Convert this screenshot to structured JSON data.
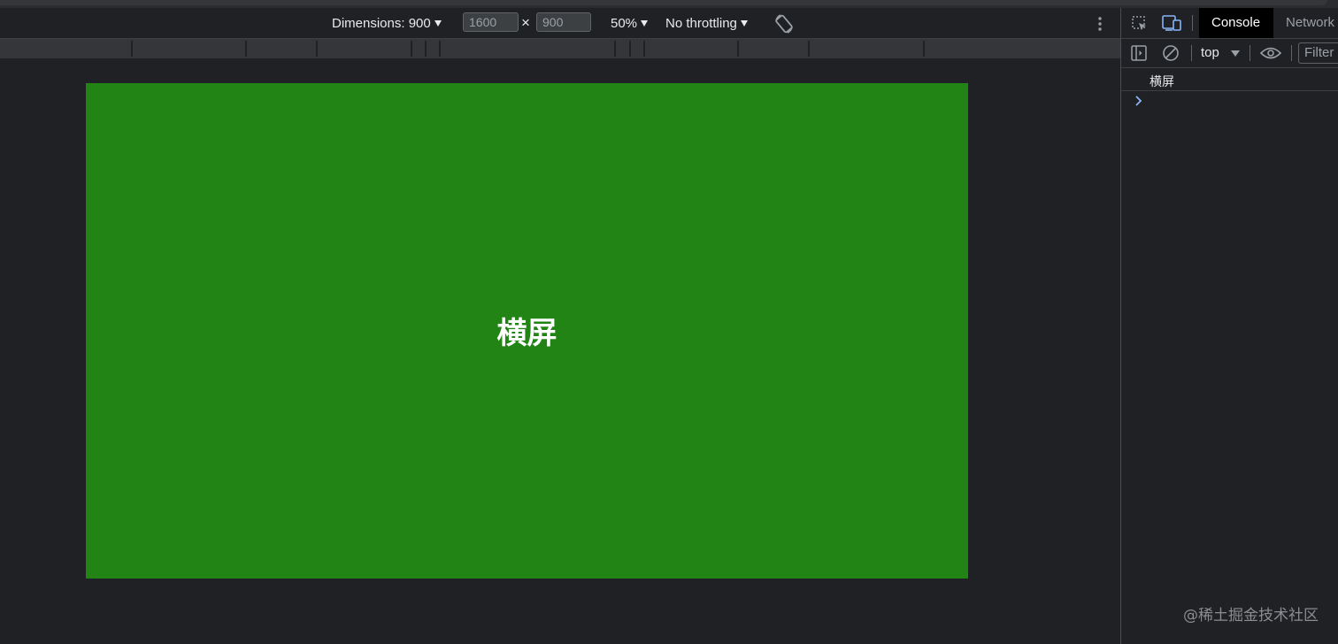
{
  "device_toolbar": {
    "dimensions_label": "Dimensions: 900",
    "width_value": "1600",
    "times_glyph": "×",
    "height_value": "900",
    "zoom_label": "50%",
    "throttling_label": "No throttling"
  },
  "viewport": {
    "screen_text": "横屏",
    "screen_color": "#238416"
  },
  "devtools": {
    "tabs": [
      "Console",
      "Network"
    ],
    "active_tab": "Console",
    "context": "top",
    "filter_placeholder": "Filter",
    "console_messages": [
      "横屏"
    ]
  },
  "watermark": "@稀土掘金技术社区",
  "colors": {
    "background": "#202124",
    "accent_blue": "#8ab4f8",
    "screen_green": "#238416"
  }
}
